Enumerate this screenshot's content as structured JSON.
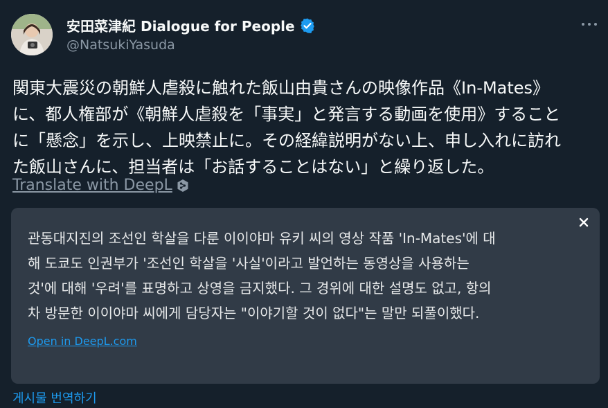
{
  "author": {
    "display_name": "安田菜津紀 Dialogue for People",
    "handle": "@NatsukiYasuda",
    "verified": true,
    "avatar_icon": "profile-photo-avatar"
  },
  "menu": {
    "icon": "more-horizontal-icon"
  },
  "tweet": {
    "lines": [
      "関東大震災の朝鮮人虐殺に触れた飯山由貴さんの映像作品《In-Mates》",
      "に、都人権部が《朝鮮人虐殺を「事実」と発言する動画を使用》すること",
      "に「懸念」を示し、上映禁止に。その経緯説明がない上、申し入れに訪れ",
      "た飯山さんに、担当者は「お話することはない」と繰り返した。"
    ],
    "translate_link": "Translate with DeepL"
  },
  "translation_panel": {
    "lines": [
      "관동대지진의 조선인 학살을 다룬 이이야마 유키 씨의 영상 작품 'In-Mates'에 대",
      "해 도쿄도 인권부가 '조선인 학살을 '사실'이라고 발언하는 동영상을 사용하는",
      "것'에 대해 '우려'를 표명하고 상영을 금지했다. 그 경위에 대한 설명도 없고, 항의",
      "차 방문한 이이야마 씨에게 담당자는 \"이야기할 것이 없다\"는 말만 되풀이했다."
    ],
    "open_link": "Open in DeepL.com",
    "close_icon": "close-icon"
  },
  "footer": {
    "translate_post": "게시물 번역하기"
  },
  "colors": {
    "background": "#15202b",
    "panel": "#313b47",
    "accent": "#1d9bf0",
    "muted": "#8b98a5"
  }
}
